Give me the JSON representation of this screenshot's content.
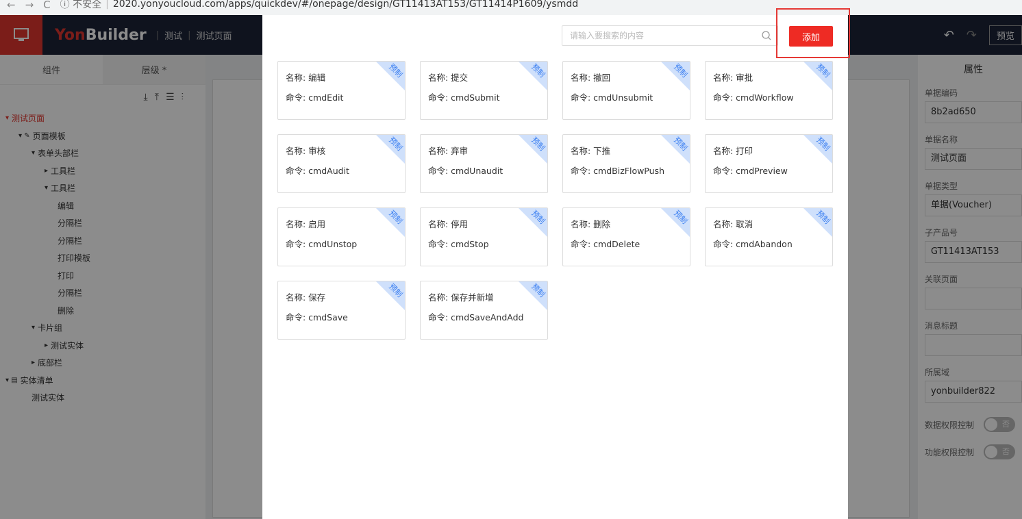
{
  "browser": {
    "nav_back": "←",
    "nav_forward": "→",
    "nav_reload": "C",
    "security": "ⓘ 不安全",
    "url": "2020.yonyoucloud.com/apps/quickdev/#/onepage/design/GT11413AT153/GT11414P1609/ysmdd"
  },
  "header": {
    "brand_yon": "Yon",
    "brand_builder": "Builder",
    "crumb_1": "测试",
    "crumb_2": "测试页面",
    "preview": "预览"
  },
  "left": {
    "tab_components": "组件",
    "tab_levels": "层级 *",
    "tree": [
      {
        "label": "测试页面",
        "indent": 0,
        "arrow": "▾",
        "red": true
      },
      {
        "label": "页面模板",
        "indent": 1,
        "arrow": "▾ ✎",
        "red": false
      },
      {
        "label": "表单头部栏",
        "indent": 2,
        "arrow": "▾",
        "red": false
      },
      {
        "label": "工具栏",
        "indent": 3,
        "arrow": "▸",
        "red": false
      },
      {
        "label": "工具栏",
        "indent": 3,
        "arrow": "▾",
        "red": false
      },
      {
        "label": "编辑",
        "indent": 4,
        "arrow": "",
        "red": false
      },
      {
        "label": "分隔栏",
        "indent": 4,
        "arrow": "",
        "red": false
      },
      {
        "label": "分隔栏",
        "indent": 4,
        "arrow": "",
        "red": false
      },
      {
        "label": "打印模板",
        "indent": 4,
        "arrow": "",
        "red": false
      },
      {
        "label": "打印",
        "indent": 4,
        "arrow": "",
        "red": false
      },
      {
        "label": "分隔栏",
        "indent": 4,
        "arrow": "",
        "red": false
      },
      {
        "label": "删除",
        "indent": 4,
        "arrow": "",
        "red": false
      },
      {
        "label": "卡片组",
        "indent": 2,
        "arrow": "▾",
        "red": false
      },
      {
        "label": "测试实体",
        "indent": 3,
        "arrow": "▸",
        "red": false
      },
      {
        "label": "底部栏",
        "indent": 2,
        "arrow": "▸",
        "red": false
      },
      {
        "label": "实体清单",
        "indent": 0,
        "arrow": "▾ ▤",
        "red": false
      },
      {
        "label": "测试实体",
        "indent": 2,
        "arrow": "",
        "red": false
      }
    ]
  },
  "right": {
    "title": "属性",
    "fields": [
      {
        "label": "单据编码",
        "value": "8b2ad650"
      },
      {
        "label": "单据名称",
        "value": "测试页面"
      },
      {
        "label": "单据类型",
        "value": "单据(Voucher)"
      },
      {
        "label": "子产品号",
        "value": "GT11413AT153"
      },
      {
        "label": "关联页面",
        "value": ""
      },
      {
        "label": "消息标题",
        "value": ""
      },
      {
        "label": "所属域",
        "value": "yonbuilder822"
      }
    ],
    "toggle_1_label": "数据权限控制",
    "toggle_1_value": "否",
    "toggle_2_label": "功能权限控制",
    "toggle_2_value": "否"
  },
  "modal": {
    "search_placeholder": "请输入要搜索的内容",
    "add_label": "添加",
    "corner_tag": "预制",
    "cards": [
      {
        "name": "名称: 编辑",
        "cmd": "命令: cmdEdit"
      },
      {
        "name": "名称: 提交",
        "cmd": "命令: cmdSubmit"
      },
      {
        "name": "名称: 撤回",
        "cmd": "命令: cmdUnsubmit"
      },
      {
        "name": "名称: 审批",
        "cmd": "命令: cmdWorkflow"
      },
      {
        "name": "名称: 审核",
        "cmd": "命令: cmdAudit"
      },
      {
        "name": "名称: 弃审",
        "cmd": "命令: cmdUnaudit"
      },
      {
        "name": "名称: 下推",
        "cmd": "命令: cmdBizFlowPush"
      },
      {
        "name": "名称: 打印",
        "cmd": "命令: cmdPreview"
      },
      {
        "name": "名称: 启用",
        "cmd": "命令: cmdUnstop"
      },
      {
        "name": "名称: 停用",
        "cmd": "命令: cmdStop"
      },
      {
        "name": "名称: 删除",
        "cmd": "命令: cmdDelete"
      },
      {
        "name": "名称: 取消",
        "cmd": "命令: cmdAbandon"
      },
      {
        "name": "名称: 保存",
        "cmd": "命令: cmdSave"
      },
      {
        "name": "名称: 保存并新增",
        "cmd": "命令: cmdSaveAndAdd"
      }
    ]
  }
}
